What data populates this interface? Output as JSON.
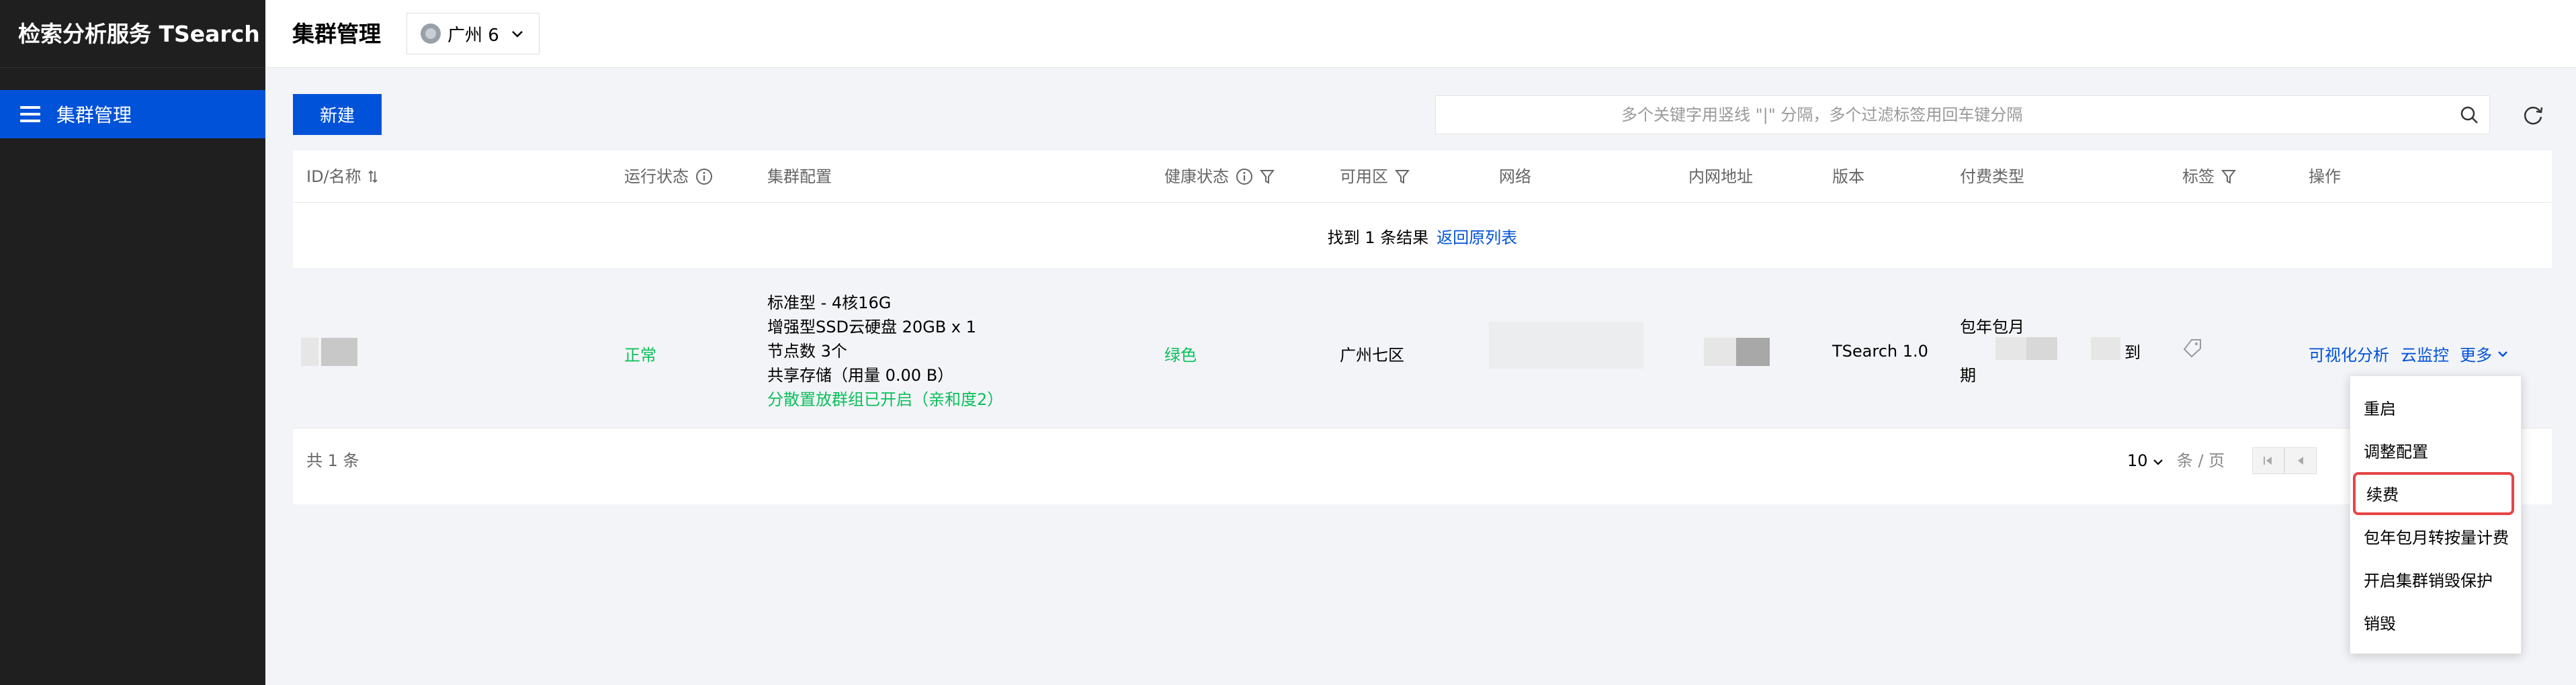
{
  "app": {
    "title": "检索分析服务 TSearch"
  },
  "sidebar": {
    "items": [
      {
        "label": "集群管理",
        "icon": "menu-icon"
      }
    ]
  },
  "header": {
    "title": "集群管理",
    "region": "广州 6"
  },
  "toolbar": {
    "new_label": "新建",
    "search_placeholder": "多个关键字用竖线 \"|\" 分隔，多个过滤标签用回车键分隔"
  },
  "table": {
    "columns": [
      "ID/名称",
      "运行状态",
      "集群配置",
      "健康状态",
      "可用区",
      "网络",
      "内网地址",
      "版本",
      "付费类型",
      "标签",
      "操作"
    ],
    "notice": {
      "text": "找到 1 条结果",
      "link": "返回原列表"
    },
    "rows": [
      {
        "status": "正常",
        "config": [
          "标准型 - 4核16G",
          "增强型SSD云硬盘 20GB x 1",
          "节点数 3个",
          "共享存储（用量 0.00 B）"
        ],
        "config_note": "分散置放群组已开启（亲和度2）",
        "health": "绿色",
        "zone": "广州七区",
        "version": "TSearch 1.0",
        "billing": {
          "line1": "包年包月",
          "line2": "期",
          "suffix": "到"
        },
        "actions": [
          "可视化分析",
          "云监控",
          "更多"
        ]
      }
    ],
    "footer": {
      "total": "共 1 条",
      "page_size": "10",
      "page_unit": "条 / 页"
    }
  },
  "dropdown": {
    "items": [
      "重启",
      "调整配置",
      "续费",
      "包年包月转按量计费",
      "开启集群销毁保护",
      "销毁"
    ],
    "highlighted": "续费"
  },
  "colors": {
    "primary": "#0052d9",
    "success": "#0abf5b",
    "sidebar": "#1f1f1f",
    "highlight": "#e54545"
  }
}
